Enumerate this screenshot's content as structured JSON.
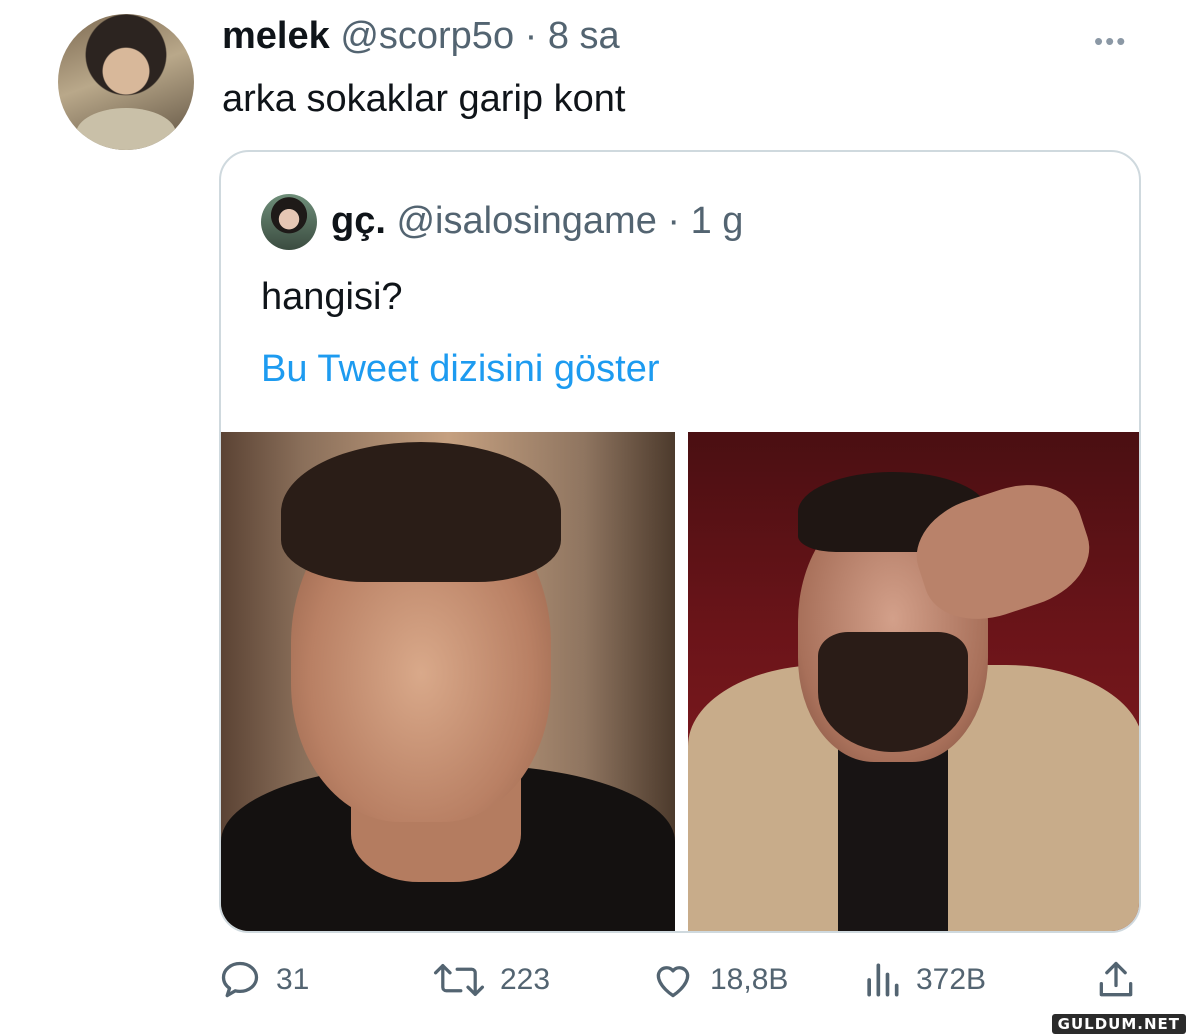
{
  "tweet": {
    "author_name": "melek",
    "author_handle": "@scorp5o",
    "separator": "·",
    "time": "8 sa",
    "more_label": "•••",
    "text": "arka sokaklar garip kont"
  },
  "quoted_tweet": {
    "author_name": "gç.",
    "author_handle": "@isalosingame",
    "separator": "·",
    "time": "1 g",
    "text": "hangisi?",
    "thread_link": "Bu Tweet dizisini göster"
  },
  "actions": {
    "replies": "31",
    "retweets": "223",
    "likes": "18,8B",
    "views": "372B"
  },
  "watermark": "GULDUM.NET",
  "colors": {
    "link": "#1d9bf0",
    "muted": "#536471",
    "border": "#cfd9de"
  }
}
